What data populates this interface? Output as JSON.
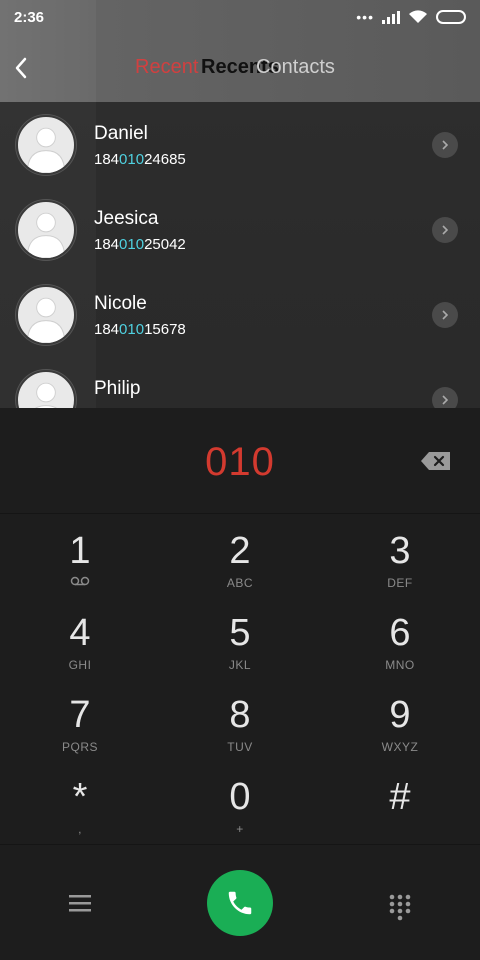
{
  "status": {
    "time": "2:36",
    "dots": "•••",
    "icons": [
      "signal-icon",
      "wifi-icon",
      "battery-icon"
    ]
  },
  "header": {
    "back_icon": "back-arrow-icon",
    "tab_recent_partial": "Recent",
    "tab_recents": "Recents",
    "tab_contacts": "Contacts"
  },
  "contacts": [
    {
      "name": "Daniel",
      "num_pre": "184",
      "num_match": "010",
      "num_post": "24685"
    },
    {
      "name": "Jeesica",
      "num_pre": "184",
      "num_match": "010",
      "num_post": "25042"
    },
    {
      "name": "Nicole",
      "num_pre": "184",
      "num_match": "010",
      "num_post": "15678"
    },
    {
      "name": "Philip",
      "num_pre": "",
      "num_match": "",
      "num_post": ""
    }
  ],
  "dial": {
    "entered": "010",
    "backspace_icon": "backspace-icon"
  },
  "keys": [
    {
      "digit": "1",
      "letters": ""
    },
    {
      "digit": "2",
      "letters": "ABC"
    },
    {
      "digit": "3",
      "letters": "DEF"
    },
    {
      "digit": "4",
      "letters": "GHI"
    },
    {
      "digit": "5",
      "letters": "JKL"
    },
    {
      "digit": "6",
      "letters": "MNO"
    },
    {
      "digit": "7",
      "letters": "PQRS"
    },
    {
      "digit": "8",
      "letters": "TUV"
    },
    {
      "digit": "9",
      "letters": "WXYZ"
    },
    {
      "digit": "*",
      "letters": ","
    },
    {
      "digit": "0",
      "letters": "+"
    },
    {
      "digit": "#",
      "letters": ""
    }
  ],
  "colors": {
    "accent_red": "#d33a2f",
    "match_cyan": "#4fd1e0",
    "call_green": "#1aae55"
  },
  "bottom": {
    "menu_icon": "menu-icon",
    "call_icon": "phone-icon",
    "dialpad_icon": "dialpad-icon"
  }
}
